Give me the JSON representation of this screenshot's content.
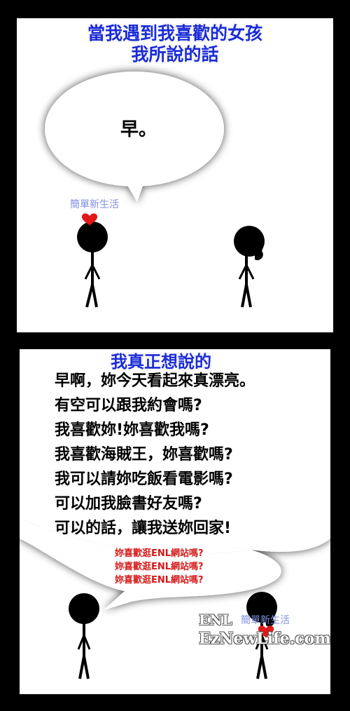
{
  "panel1": {
    "title_line1": "當我遇到我喜歡的女孩",
    "title_line2": "我所說的話",
    "speech": "早。",
    "watermark": "簡單新生活"
  },
  "panel2": {
    "title": "我真正想說的",
    "lines": [
      "早啊，妳今天看起來真漂亮。",
      "有空可以跟我約會嗎?",
      "我喜歡妳!妳喜歡我嗎?",
      "我喜歡海賊王，妳喜歡嗎?",
      "我可以請妳吃飯看電影嗎?",
      "可以加我臉書好友嗎?",
      "可以的話，讓我送妳回家!"
    ],
    "red_lines": [
      "妳喜歡逛ENL網站嗎?",
      "妳喜歡逛ENL網站嗎?",
      "妳喜歡逛ENL網站嗎?"
    ],
    "logo_enl": "ENL",
    "logo_cn": "簡單新生活",
    "logo_url": "EzNewLife.com"
  },
  "colors": {
    "title_blue": "#1a2bd6",
    "heart_red": "#e01818",
    "note_red": "#d51a1a",
    "background": "#000000"
  }
}
